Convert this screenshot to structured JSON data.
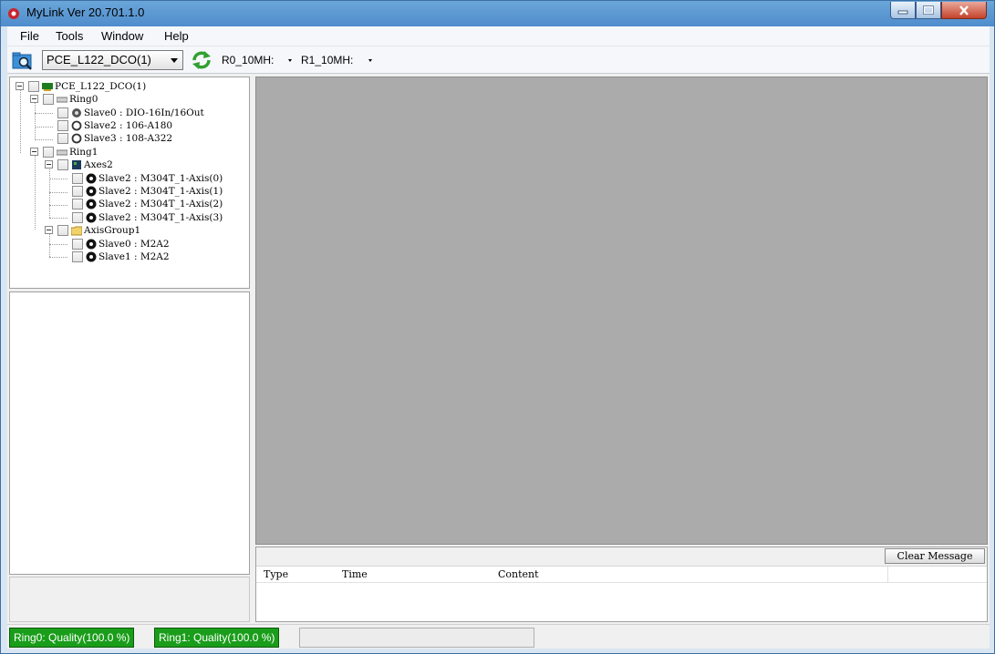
{
  "window": {
    "title": "MyLink  Ver 20.701.1.0"
  },
  "menu": {
    "items": [
      "File",
      "Tools",
      "Window",
      "Help"
    ]
  },
  "toolbar": {
    "device": "PCE_L122_DCO(1)",
    "r0_rate": "R0_10MH:",
    "r1_rate": "R1_10MH:"
  },
  "tree": {
    "root": "PCE_L122_DCO(1)",
    "ring0": {
      "label": "Ring0",
      "children": [
        "Slave0 : DIO-16In/16Out",
        "Slave2 : 106-A180",
        "Slave3 : 108-A322"
      ]
    },
    "ring1": {
      "label": "Ring1",
      "axes": {
        "label": "Axes2",
        "children": [
          "Slave2 : M304T_1-Axis(0)",
          "Slave2 : M304T_1-Axis(1)",
          "Slave2 : M304T_1-Axis(2)",
          "Slave2 : M304T_1-Axis(3)"
        ]
      },
      "group": {
        "label": "AxisGroup1",
        "children": [
          "Slave0 : M2A2",
          "Slave1 : M2A2"
        ]
      }
    }
  },
  "messages": {
    "clear_label": "Clear Message",
    "columns": [
      "Type",
      "Time",
      "Content"
    ]
  },
  "status": {
    "ring0": "Ring0: Quality(100.0 %)",
    "ring1": "Ring1: Quality(100.0 %)"
  },
  "colors": {
    "status_ok": "#1a9d1a",
    "workspace": "#ababab",
    "close_button": "#c4432b"
  }
}
